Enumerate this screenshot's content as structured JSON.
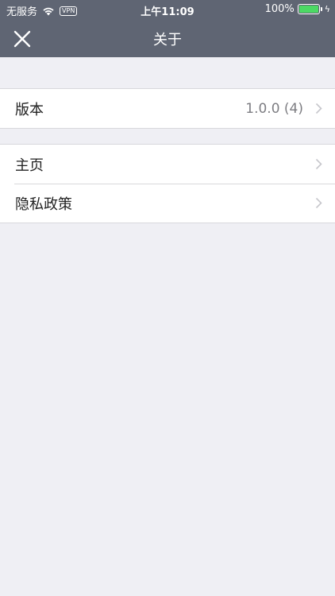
{
  "status_bar": {
    "carrier": "无服务",
    "vpn": "VPN",
    "time": "上午11:09",
    "battery": "100%",
    "battery_level": 1.0
  },
  "nav": {
    "title": "关于",
    "close_icon": "close-icon"
  },
  "sections": [
    {
      "rows": [
        {
          "label": "版本",
          "value": "1.0.0 (4)"
        }
      ]
    },
    {
      "rows": [
        {
          "label": "主页"
        },
        {
          "label": "隐私政策"
        }
      ]
    }
  ],
  "colors": {
    "nav_background": "#5f6573",
    "page_background": "#efeff4",
    "battery_fill": "#4cd964"
  }
}
